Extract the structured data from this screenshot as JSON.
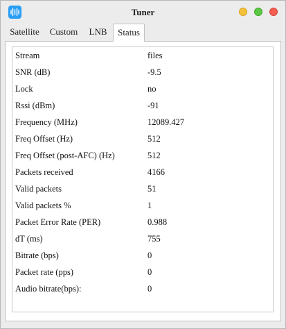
{
  "window": {
    "title": "Tuner"
  },
  "tabs": [
    {
      "label": "Satellite"
    },
    {
      "label": "Custom"
    },
    {
      "label": "LNB"
    },
    {
      "label": "Status",
      "active": true
    }
  ],
  "status_rows": [
    {
      "label": "Stream",
      "value": "files"
    },
    {
      "label": "SNR (dB)",
      "value": "-9.5"
    },
    {
      "label": "Lock",
      "value": "no"
    },
    {
      "label": "Rssi (dBm)",
      "value": "-91"
    },
    {
      "label": "Frequency (MHz)",
      "value": "12089.427"
    },
    {
      "label": "Freq Offset (Hz)",
      "value": "512"
    },
    {
      "label": "Freq Offset (post-AFC) (Hz)",
      "value": "512"
    },
    {
      "label": "Packets received",
      "value": "4166"
    },
    {
      "label": "Valid packets",
      "value": "51"
    },
    {
      "label": "Valid packets %",
      "value": "1"
    },
    {
      "label": "Packet Error Rate (PER)",
      "value": "0.988"
    },
    {
      "label": "dT (ms)",
      "value": "755"
    },
    {
      "label": "Bitrate (bps)",
      "value": "0"
    },
    {
      "label": "Packet rate (pps)",
      "value": "0"
    },
    {
      "label": "Audio bitrate(bps):",
      "value": "0"
    }
  ],
  "colors": {
    "app_icon": "#2a9df4",
    "minimize": "#f4c23a",
    "maximize": "#5cc944",
    "close": "#f35d52"
  }
}
